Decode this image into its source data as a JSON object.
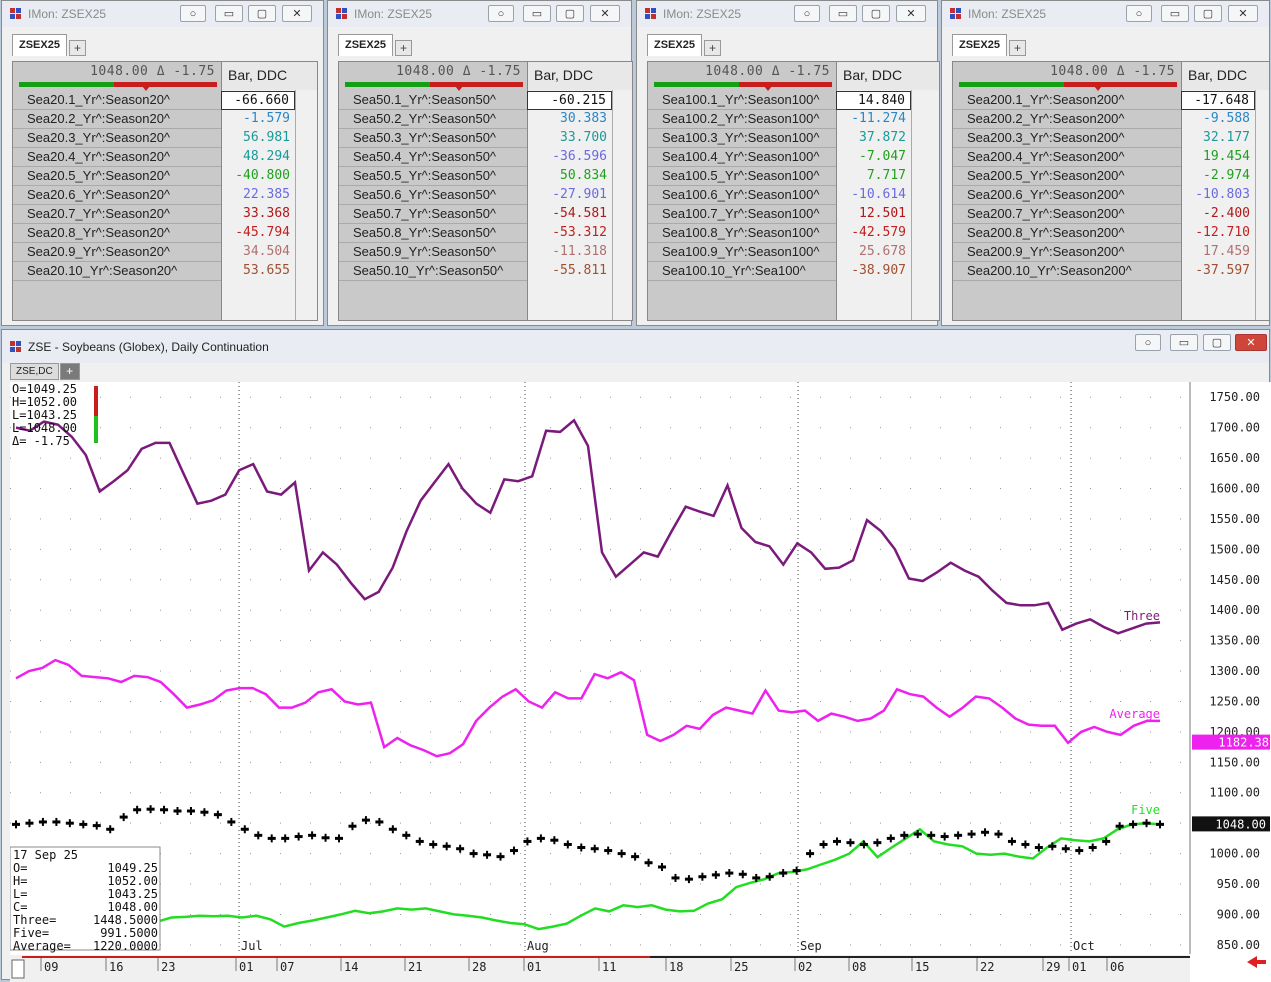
{
  "monitors": [
    {
      "title": "IMon: ZSEX25",
      "tab": "ZSEX25",
      "quote": "1048.00 Δ -1.75",
      "column": "Bar, DDC",
      "rows": [
        {
          "label": "Sea20.1_Yr^:Season20^",
          "value": "-66.660",
          "color": "#111111"
        },
        {
          "label": "Sea20.2_Yr^:Season20^",
          "value": "-1.579",
          "color": "#2a86c8"
        },
        {
          "label": "Sea20.3_Yr^:Season20^",
          "value": "56.981",
          "color": "#1a9a9a"
        },
        {
          "label": "Sea20.4_Yr^:Season20^",
          "value": "48.294",
          "color": "#1a9a9a"
        },
        {
          "label": "Sea20.5_Yr^:Season20^",
          "value": "-40.800",
          "color": "#1fa01f"
        },
        {
          "label": "Sea20.6_Yr^:Season20^",
          "value": "22.385",
          "color": "#6a6ae0"
        },
        {
          "label": "Sea20.7_Yr^:Season20^",
          "value": "33.368",
          "color": "#b01818"
        },
        {
          "label": "Sea20.8_Yr^:Season20^",
          "value": "-45.794",
          "color": "#c02020"
        },
        {
          "label": "Sea20.9_Yr^:Season20^",
          "value": "34.504",
          "color": "#b07070"
        },
        {
          "label": "Sea20.10_Yr^:Season20^",
          "value": "53.655",
          "color": "#a05030"
        }
      ]
    },
    {
      "title": "IMon: ZSEX25",
      "tab": "ZSEX25",
      "quote": "1048.00 Δ -1.75",
      "column": "Bar, DDC",
      "rows": [
        {
          "label": "Sea50.1_Yr^:Season50^",
          "value": "-60.215",
          "color": "#111111"
        },
        {
          "label": "Sea50.2_Yr^:Season50^",
          "value": "30.383",
          "color": "#2a86c8"
        },
        {
          "label": "Sea50.3_Yr^:Season50^",
          "value": "33.700",
          "color": "#1a9a9a"
        },
        {
          "label": "Sea50.4_Yr^:Season50^",
          "value": "-36.596",
          "color": "#6a6ae0"
        },
        {
          "label": "Sea50.5_Yr^:Season50^",
          "value": "50.834",
          "color": "#1fa01f"
        },
        {
          "label": "Sea50.6_Yr^:Season50^",
          "value": "-27.901",
          "color": "#6a6ae0"
        },
        {
          "label": "Sea50.7_Yr^:Season50^",
          "value": "-54.581",
          "color": "#b01818"
        },
        {
          "label": "Sea50.8_Yr^:Season50^",
          "value": "-53.312",
          "color": "#c02020"
        },
        {
          "label": "Sea50.9_Yr^:Season50^",
          "value": "-11.318",
          "color": "#b07070"
        },
        {
          "label": "Sea50.10_Yr^:Season50^",
          "value": "-55.811",
          "color": "#a05030"
        }
      ]
    },
    {
      "title": "IMon: ZSEX25",
      "tab": "ZSEX25",
      "quote": "1048.00 Δ -1.75",
      "column": "Bar, DDC",
      "rows": [
        {
          "label": "Sea100.1_Yr^:Season100^",
          "value": "14.840",
          "color": "#111111"
        },
        {
          "label": "Sea100.2_Yr^:Season100^",
          "value": "-11.274",
          "color": "#2a86c8"
        },
        {
          "label": "Sea100.3_Yr^:Season100^",
          "value": "37.872",
          "color": "#1a9a9a"
        },
        {
          "label": "Sea100.4_Yr^:Season100^",
          "value": "-7.047",
          "color": "#1fa01f"
        },
        {
          "label": "Sea100.5_Yr^:Season100^",
          "value": "7.717",
          "color": "#1fa01f"
        },
        {
          "label": "Sea100.6_Yr^:Season100^",
          "value": "-10.614",
          "color": "#6a6ae0"
        },
        {
          "label": "Sea100.7_Yr^:Season100^",
          "value": "12.501",
          "color": "#b01818"
        },
        {
          "label": "Sea100.8_Yr^:Season100^",
          "value": "-42.579",
          "color": "#c02020"
        },
        {
          "label": "Sea100.9_Yr^:Season100^",
          "value": "25.678",
          "color": "#b07070"
        },
        {
          "label": "Sea100.10_Yr^:Sea100^",
          "value": "-38.907",
          "color": "#a05030"
        }
      ]
    },
    {
      "title": "IMon: ZSEX25",
      "tab": "ZSEX25",
      "quote": "1048.00 Δ -1.75",
      "column": "Bar, DDC",
      "rows": [
        {
          "label": "Sea200.1_Yr^:Season200^",
          "value": "-17.648",
          "color": "#111111"
        },
        {
          "label": "Sea200.2_Yr^:Season200^",
          "value": "-9.588",
          "color": "#2a86c8"
        },
        {
          "label": "Sea200.3_Yr^:Season200^",
          "value": "32.177",
          "color": "#1a9a9a"
        },
        {
          "label": "Sea200.4_Yr^:Season200^",
          "value": "19.454",
          "color": "#1fa01f"
        },
        {
          "label": "Sea200.5_Yr^:Season200^",
          "value": "-2.974",
          "color": "#1fa01f"
        },
        {
          "label": "Sea200.6_Yr^:Season200^",
          "value": "-10.803",
          "color": "#6a6ae0"
        },
        {
          "label": "Sea200.7_Yr^:Season200^",
          "value": "-2.400",
          "color": "#b01818"
        },
        {
          "label": "Sea200.8_Yr^:Season200^",
          "value": "-12.710",
          "color": "#c02020"
        },
        {
          "label": "Sea200.9_Yr^:Season200^",
          "value": "17.459",
          "color": "#b07070"
        },
        {
          "label": "Sea200.10_Yr^:Season200^",
          "value": "-37.597",
          "color": "#a05030"
        }
      ]
    }
  ],
  "chart_window": {
    "title": "ZSE - Soybeans (Globex), Daily Continuation",
    "tab": "ZSE,DC",
    "ohlc_box": [
      "O=1049.25",
      "H=1052.00",
      "L=1043.25",
      "L=1048.00",
      "Δ=   -1.75"
    ],
    "cursor_box": {
      "date": "17 Sep 25",
      "rows": [
        {
          "k": "O=",
          "v": "1049.25"
        },
        {
          "k": "H=",
          "v": "1052.00"
        },
        {
          "k": "L=",
          "v": "1043.25"
        },
        {
          "k": "C=",
          "v": "1048.00"
        },
        {
          "k": "Three=",
          "v": "1448.5000"
        },
        {
          "k": "Five=",
          "v": "991.5000"
        },
        {
          "k": "Average=",
          "v": "1220.0000"
        }
      ]
    },
    "series_labels": {
      "three": "Three",
      "average": "Average",
      "five": "Five"
    },
    "price_tags": {
      "average": "1182.38",
      "last": "1048.00"
    },
    "colors": {
      "three": "#7a1a7a",
      "average": "#ee22ee",
      "five": "#22dd22",
      "bars": "#000000",
      "cursor_line": "#c81e1e"
    }
  },
  "chart_data": {
    "type": "line",
    "ylim": [
      835,
      1775
    ],
    "yticks": [
      "1750.00",
      "1700.00",
      "1650.00",
      "1600.00",
      "1550.00",
      "1500.00",
      "1450.00",
      "1400.00",
      "1350.00",
      "1300.00",
      "1250.00",
      "1200.00",
      "1150.00",
      "1100.00",
      "1050.00",
      "1000.00",
      "950.00",
      "900.00",
      "850.00"
    ],
    "month_labels": [
      "Jul",
      "Aug",
      "Sep",
      "Oct"
    ],
    "date_ticks": [
      "09",
      "16",
      "23",
      "01",
      "07",
      "14",
      "21",
      "28",
      "01",
      "11",
      "18",
      "25",
      "02",
      "08",
      "15",
      "22",
      "29",
      "01",
      "06"
    ],
    "series": [
      {
        "name": "Three",
        "values": [
          1700,
          1695,
          1710,
          1705,
          1685,
          1655,
          1595,
          1612,
          1630,
          1665,
          1675,
          1675,
          1625,
          1575,
          1580,
          1590,
          1630,
          1640,
          1595,
          1590,
          1610,
          1465,
          1495,
          1475,
          1445,
          1418,
          1430,
          1470,
          1530,
          1580,
          1610,
          1640,
          1600,
          1575,
          1560,
          1615,
          1612,
          1620,
          1695,
          1693,
          1712,
          1670,
          1495,
          1455,
          1475,
          1495,
          1488,
          1530,
          1570,
          1562,
          1555,
          1605,
          1535,
          1512,
          1505,
          1475,
          1510,
          1495,
          1468,
          1470,
          1482,
          1548,
          1530,
          1500,
          1452,
          1448,
          1462,
          1478,
          1465,
          1455,
          1432,
          1412,
          1408,
          1408,
          1412,
          1368,
          1378,
          1385,
          1372,
          1362,
          1370,
          1378,
          1380
        ]
      },
      {
        "name": "Average",
        "values": [
          1288,
          1300,
          1305,
          1318,
          1310,
          1292,
          1290,
          1288,
          1282,
          1292,
          1290,
          1282,
          1262,
          1240,
          1245,
          1252,
          1268,
          1272,
          1272,
          1262,
          1240,
          1240,
          1248,
          1265,
          1270,
          1250,
          1245,
          1248,
          1175,
          1190,
          1178,
          1170,
          1160,
          1165,
          1180,
          1218,
          1240,
          1258,
          1270,
          1250,
          1240,
          1265,
          1255,
          1255,
          1295,
          1288,
          1298,
          1285,
          1195,
          1185,
          1195,
          1210,
          1205,
          1228,
          1240,
          1235,
          1230,
          1268,
          1235,
          1232,
          1235,
          1218,
          1230,
          1225,
          1218,
          1222,
          1235,
          1270,
          1262,
          1258,
          1240,
          1225,
          1240,
          1258,
          1255,
          1240,
          1222,
          1212,
          1210,
          1210,
          1182,
          1200,
          1208,
          1200,
          1195,
          1210,
          1218,
          1218
        ]
      },
      {
        "name": "Five",
        "values": [
          880,
          880,
          880,
          878,
          876,
          874,
          872,
          870,
          866,
          868,
          888,
          895,
          896,
          898,
          897,
          898,
          895,
          898,
          892,
          880,
          886,
          890,
          895,
          900,
          906,
          902,
          905,
          910,
          908,
          910,
          905,
          900,
          898,
          895,
          890,
          886,
          884,
          876,
          880,
          885,
          898,
          910,
          905,
          915,
          912,
          915,
          908,
          905,
          906,
          918,
          925,
          945,
          952,
          958,
          968,
          970,
          974,
          982,
          990,
          1000,
          1020,
          994,
          1010,
          1025,
          1040,
          1020,
          1015,
          1012,
          1000,
          998,
          1000,
          995,
          992,
          1010,
          1025,
          1022,
          1020,
          1025,
          1040,
          1048,
          1050,
          1048
        ]
      },
      {
        "name": "ZSE",
        "values": [
          1048,
          1050,
          1052,
          1052,
          1050,
          1048,
          1046,
          1040,
          1060,
          1072,
          1073,
          1072,
          1070,
          1070,
          1068,
          1064,
          1052,
          1040,
          1030,
          1025,
          1025,
          1028,
          1030,
          1026,
          1025,
          1045,
          1055,
          1052,
          1040,
          1030,
          1020,
          1015,
          1012,
          1008,
          1000,
          998,
          995,
          1005,
          1020,
          1025,
          1022,
          1015,
          1010,
          1008,
          1005,
          1000,
          995,
          985,
          978,
          960,
          958,
          962,
          965,
          968,
          966,
          960,
          962,
          968,
          972,
          1000,
          1015,
          1020,
          1018,
          1015,
          1018,
          1025,
          1030,
          1032,
          1030,
          1028,
          1030,
          1032,
          1035,
          1032,
          1020,
          1015,
          1010,
          1012,
          1008,
          1005,
          1010,
          1020,
          1045,
          1048,
          1050,
          1048
        ]
      }
    ]
  }
}
